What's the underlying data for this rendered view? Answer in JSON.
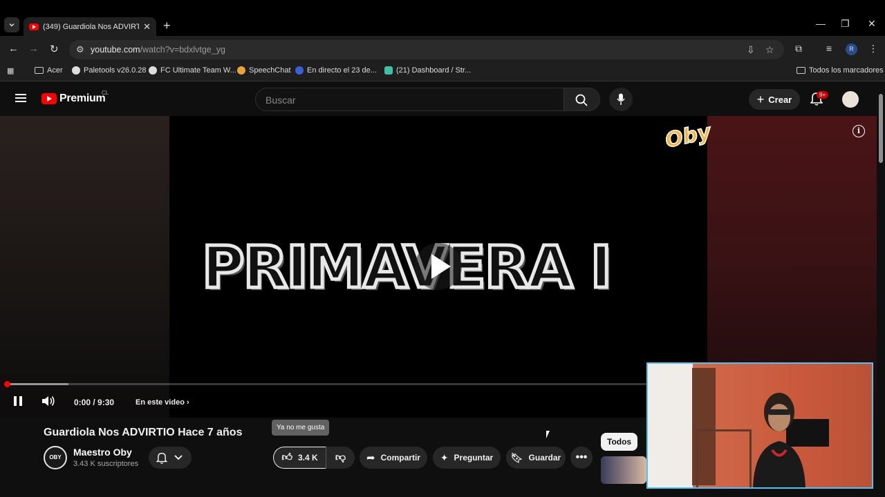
{
  "browser": {
    "tab_title": "(349) Guardiola Nos ADVIRTI",
    "url_host": "youtube.com",
    "url_path": "/watch?v=bdxlvtge_yg",
    "bookmarks": [
      {
        "label": "Acer",
        "icon": "folder-icon"
      },
      {
        "label": "Paletools v26.0.28",
        "icon": "globe-icon"
      },
      {
        "label": "FC Ultimate Team W...",
        "icon": "globe-icon"
      },
      {
        "label": "SpeechChat",
        "icon": "speechchat-icon"
      },
      {
        "label": "En directo el 23 de...",
        "icon": "r-icon"
      },
      {
        "label": "(21) Dashboard / Str...",
        "icon": "dashboard-icon"
      }
    ],
    "all_bookmarks": "Todos los marcadores",
    "profile_initial": "R"
  },
  "header": {
    "brand": "Premium",
    "country": "CL",
    "search_placeholder": "Buscar",
    "create_label": "Crear",
    "notif_count": "9+"
  },
  "player": {
    "title_card": "PRIMAVERA I",
    "watermark": "Oby",
    "time": "0:00 / 9:30",
    "chapters_label": "En este video",
    "progress_buffered": 0.07,
    "progress_played": 0.0
  },
  "video": {
    "title": "Guardiola Nos ADVIRTIO Hace 7 años",
    "channel": "Maestro Oby",
    "channel_avatar_text": "OBY",
    "subscribers": "3.43 K suscriptores",
    "likes": "3.4 K",
    "tooltip": "Ya no me gusta",
    "share": "Compartir",
    "ask": "Preguntar",
    "save": "Guardar"
  },
  "sidebar": {
    "chip": "Todos"
  },
  "colors": {
    "youtube_red": "#ff0000",
    "webcam_border": "#4fc3f7",
    "background": "#0f0f0f"
  }
}
